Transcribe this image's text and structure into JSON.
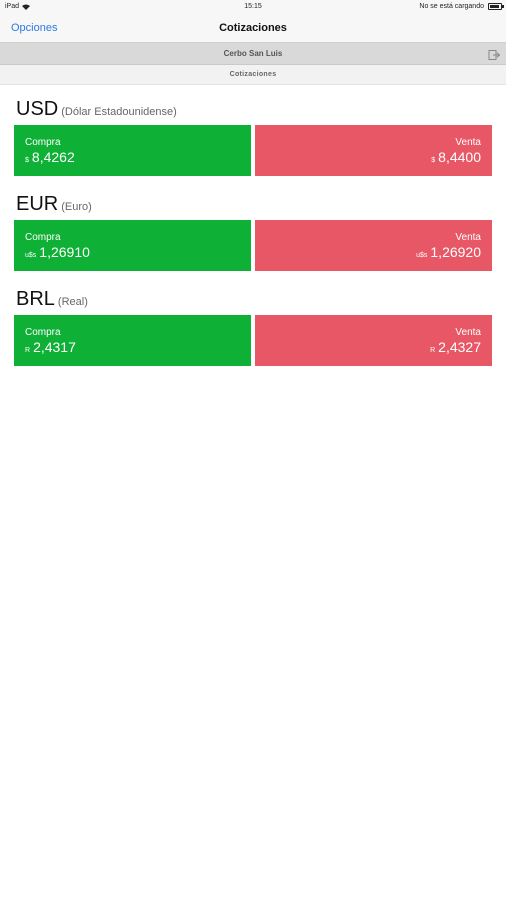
{
  "status_bar": {
    "device": "iPad",
    "time": "15:15",
    "charging": "No se está cargando"
  },
  "nav": {
    "back_label": "Opciones",
    "title": "Cotizaciones"
  },
  "subheader": {
    "name": "Cerbo San Luis",
    "icon": "logout-icon"
  },
  "section": {
    "label": "Cotizaciones"
  },
  "currencies": [
    {
      "code": "USD",
      "description": "(Dólar Estadounidense)",
      "buy_label": "Compra",
      "buy_symbol": "$",
      "buy_value": "8,4262",
      "sell_label": "Venta",
      "sell_symbol": "$",
      "sell_value": "8,4400"
    },
    {
      "code": "EUR",
      "description": "(Euro)",
      "buy_label": "Compra",
      "buy_symbol": "u$s",
      "buy_value": "1,26910",
      "sell_label": "Venta",
      "sell_symbol": "u$s",
      "sell_value": "1,26920"
    },
    {
      "code": "BRL",
      "description": "(Real)",
      "buy_label": "Compra",
      "buy_symbol": "R",
      "buy_value": "2,4317",
      "sell_label": "Venta",
      "sell_symbol": "R",
      "sell_value": "2,4327"
    }
  ],
  "colors": {
    "buy": "#0eb035",
    "sell": "#e85766",
    "accent": "#2a7ae2"
  }
}
